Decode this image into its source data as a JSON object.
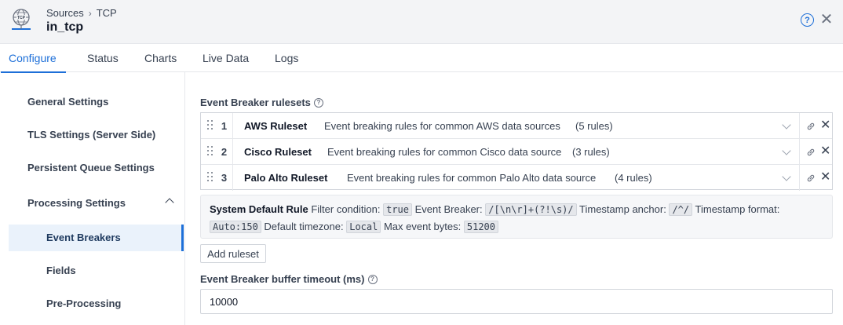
{
  "header": {
    "breadcrumb": [
      "Sources",
      "TCP"
    ],
    "breadcrumb_sep": "›",
    "title": "in_tcp",
    "logo_text": "TCP",
    "help_label": "?",
    "close_label": "✕"
  },
  "tabs": [
    {
      "label": "Configure",
      "active": true
    },
    {
      "label": "Status",
      "active": false
    },
    {
      "label": "Charts",
      "active": false
    },
    {
      "label": "Live Data",
      "active": false
    },
    {
      "label": "Logs",
      "active": false
    }
  ],
  "sidebar": {
    "items": [
      {
        "label": "General Settings",
        "level": "top"
      },
      {
        "label": "TLS Settings (Server Side)",
        "level": "top"
      },
      {
        "label": "Persistent Queue Settings",
        "level": "top"
      },
      {
        "label": "Processing Settings",
        "level": "top",
        "expanded": true
      },
      {
        "label": "Event Breakers",
        "level": "sub",
        "active": true
      },
      {
        "label": "Fields",
        "level": "sub"
      },
      {
        "label": "Pre-Processing",
        "level": "sub"
      }
    ]
  },
  "event_breaker": {
    "section_label": "Event Breaker rulesets",
    "rulesets": [
      {
        "num": "1",
        "name": "AWS Ruleset",
        "description": "Event breaking rules for common AWS data sources",
        "count": "(5 rules)"
      },
      {
        "num": "2",
        "name": "Cisco Ruleset",
        "description": "Event breaking rules for common Cisco data source",
        "count": "(3 rules)"
      },
      {
        "num": "3",
        "name": "Palo Alto Ruleset",
        "description": "Event breaking rules for common Palo Alto data source",
        "count": "(4 rules)"
      }
    ],
    "system_default": {
      "title": "System Default Rule",
      "filter_label": "Filter condition:",
      "filter_value": "true",
      "breaker_label": "Event Breaker:",
      "breaker_value": "/[\\n\\r]+(?!\\s)/",
      "anchor_label": "Timestamp anchor:",
      "anchor_value": "/^/",
      "format_label": "Timestamp format:",
      "format_value": "Auto:150",
      "tz_label": "Default timezone:",
      "tz_value": "Local",
      "max_label": "Max event bytes:",
      "max_value": "51200"
    },
    "add_ruleset_label": "Add ruleset",
    "timeout_label": "Event Breaker buffer timeout (ms)",
    "timeout_value": "10000"
  },
  "colors": {
    "accent": "#1d6fd8",
    "header_bg": "#f3f4f6",
    "active_item_bg": "#eaf2fb"
  }
}
